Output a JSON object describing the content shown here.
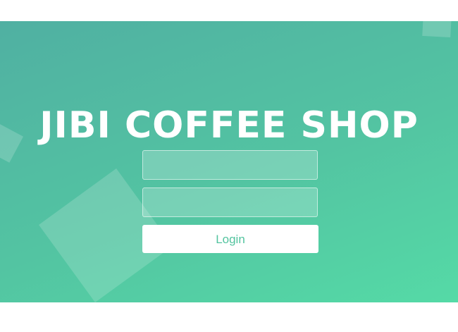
{
  "header": {
    "title": "JIBI COFFEE SHOP"
  },
  "login_form": {
    "username": {
      "value": "",
      "placeholder": ""
    },
    "password": {
      "value": "",
      "placeholder": ""
    },
    "login_label": "Login"
  },
  "colors": {
    "gradient_start": "#50b0a2",
    "gradient_end": "#55daa6",
    "button_text": "#53c49f",
    "title": "#ffffff"
  }
}
